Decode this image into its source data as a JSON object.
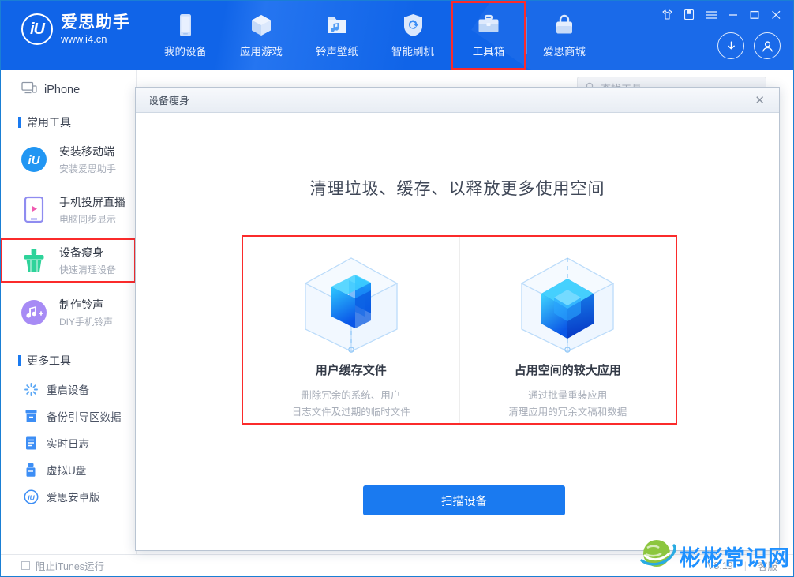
{
  "header": {
    "brand": {
      "mark": "iU",
      "name": "爱思助手",
      "url": "www.i4.cn"
    },
    "nav": [
      {
        "label": "我的设备",
        "icon": "phone-icon"
      },
      {
        "label": "应用游戏",
        "icon": "cube-icon"
      },
      {
        "label": "铃声壁纸",
        "icon": "music-folder-icon"
      },
      {
        "label": "智能刷机",
        "icon": "shield-refresh-icon"
      },
      {
        "label": "工具箱",
        "icon": "toolbox-icon"
      },
      {
        "label": "爱思商城",
        "icon": "shopping-bag-icon"
      }
    ],
    "selected_nav": "工具箱",
    "window_buttons": [
      "shirt-icon",
      "save-icon",
      "menu-icon",
      "minimize-icon",
      "maximize-icon",
      "close-icon"
    ],
    "account_buttons": [
      "download-icon",
      "user-icon"
    ]
  },
  "sidebar": {
    "device": {
      "label": "iPhone",
      "icon": "monitor-icon"
    },
    "common_section": "常用工具",
    "tools": [
      {
        "name": "安装移动端",
        "desc": "安装爱思助手",
        "icon": "i4-logo-icon",
        "highlighted": false
      },
      {
        "name": "手机投屏直播",
        "desc": "电脑同步显示",
        "icon": "screen-cast-icon",
        "highlighted": false
      },
      {
        "name": "设备瘦身",
        "desc": "快速清理设备",
        "icon": "broom-icon",
        "highlighted": true
      },
      {
        "name": "制作铃声",
        "desc": "DIY手机铃声",
        "icon": "ringtone-icon",
        "highlighted": false
      }
    ],
    "more_section": "更多工具",
    "more_tools": [
      {
        "label": "重启设备",
        "icon": "restart-icon"
      },
      {
        "label": "备份引导区数据",
        "icon": "backup-icon"
      },
      {
        "label": "实时日志",
        "icon": "log-icon"
      },
      {
        "label": "虚拟U盘",
        "icon": "usb-icon"
      },
      {
        "label": "爱思安卓版",
        "icon": "i4-android-icon"
      }
    ]
  },
  "content": {
    "search_placeholder": "查找工具"
  },
  "modal": {
    "title": "设备瘦身",
    "close": "✕",
    "heading": "清理垃圾、缓存、以释放更多使用空间",
    "cards": [
      {
        "title": "用户缓存文件",
        "desc_line1": "删除冗余的系统、用户",
        "desc_line2": "日志文件及过期的临时文件",
        "icon": "cube-files-icon"
      },
      {
        "title": "占用空间的较大应用",
        "desc_line1": "通过批量重装应用",
        "desc_line2": "清理应用的冗余文稿和数据",
        "icon": "cube-core-icon"
      }
    ],
    "scan_button": "扫描设备"
  },
  "statusbar": {
    "block_itunes": "阻止iTunes运行",
    "version": "V8.19",
    "separator": "|",
    "support": "客服"
  },
  "watermark": {
    "text": "彬彬常识网"
  },
  "colors": {
    "header_blue": "#1064e8",
    "accent_blue": "#1a7af0",
    "highlight_red": "#fb2b2b",
    "broom_green": "#2ed39a",
    "watermark_blue": "#1e90ff"
  }
}
